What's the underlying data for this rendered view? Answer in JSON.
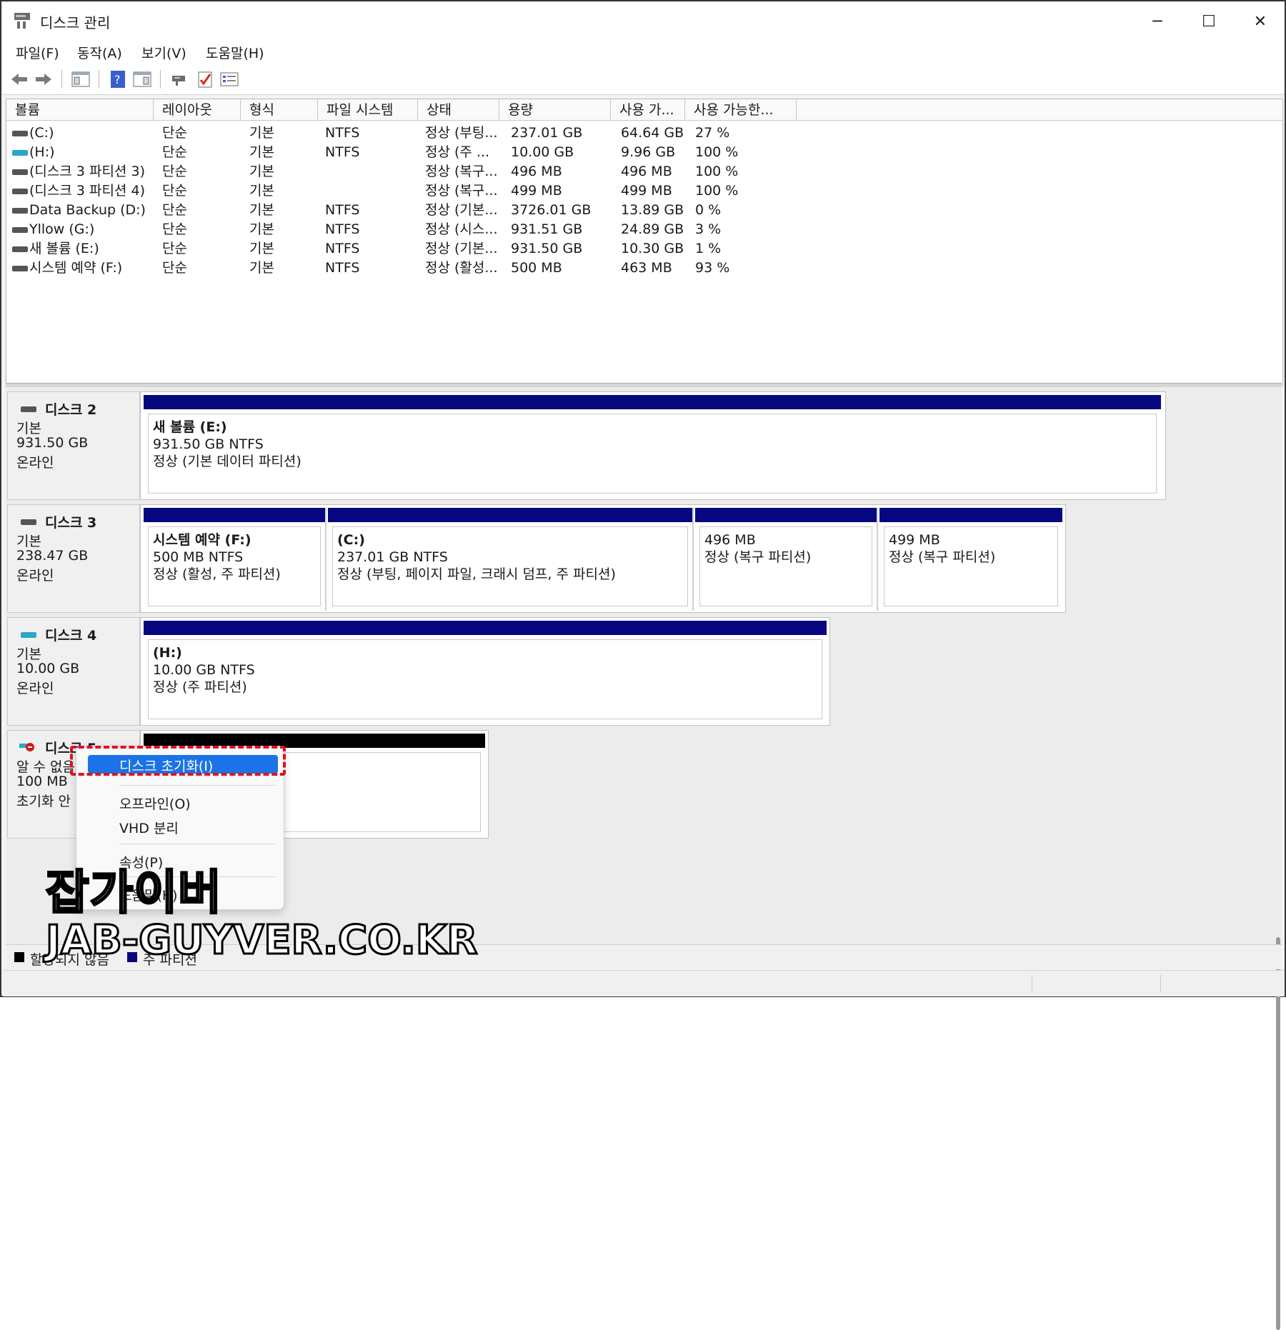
{
  "window": {
    "title": "디스크 관리",
    "minimize": "─",
    "maximize": "☐",
    "close": "✕"
  },
  "menu": [
    "파일(F)",
    "동작(A)",
    "보기(V)",
    "도움말(H)"
  ],
  "toolbar_icons": [
    "back-icon",
    "forward-icon",
    "show-hide-console-icon",
    "help-icon",
    "action-pane-icon",
    "connect-icon",
    "check-icon",
    "properties-icon"
  ],
  "volume_table": {
    "headers": [
      "볼륨",
      "레이아웃",
      "형식",
      "파일 시스템",
      "상태",
      "용량",
      "사용 가...",
      "사용 가능한..."
    ],
    "rows": [
      [
        "(C:)",
        "단순",
        "기본",
        "NTFS",
        "정상 (부팅...",
        "237.01 GB",
        "64.64 GB",
        "27 %"
      ],
      [
        "(H:)",
        "단순",
        "기본",
        "NTFS",
        "정상 (주 ...",
        "10.00 GB",
        "9.96 GB",
        "100 %"
      ],
      [
        "(디스크 3 파티션 3)",
        "단순",
        "기본",
        "",
        "정상 (복구...",
        "496 MB",
        "496 MB",
        "100 %"
      ],
      [
        "(디스크 3 파티션 4)",
        "단순",
        "기본",
        "",
        "정상 (복구...",
        "499 MB",
        "499 MB",
        "100 %"
      ],
      [
        "Data Backup (D:)",
        "단순",
        "기본",
        "NTFS",
        "정상 (기본...",
        "3726.01 GB",
        "13.89 GB",
        "0 %"
      ],
      [
        "Yllow (G:)",
        "단순",
        "기본",
        "NTFS",
        "정상 (시스...",
        "931.51 GB",
        "24.89 GB",
        "3 %"
      ],
      [
        "새 볼륨 (E:)",
        "단순",
        "기본",
        "NTFS",
        "정상 (기본...",
        "931.50 GB",
        "10.30 GB",
        "1 %"
      ],
      [
        "시스템 예약 (F:)",
        "단순",
        "기본",
        "NTFS",
        "정상 (활성...",
        "500 MB",
        "463 MB",
        "93 %"
      ]
    ]
  },
  "disks": [
    {
      "name": "디스크 2",
      "type": "기본",
      "size": "931.50 GB",
      "state": "온라인",
      "partitions": [
        {
          "name": "새 볼륨  (E:)",
          "size": "931.50 GB NTFS",
          "status": "정상 (기본 데이터 파티션)"
        }
      ]
    },
    {
      "name": "디스크 3",
      "type": "기본",
      "size": "238.47 GB",
      "state": "온라인",
      "partitions": [
        {
          "name": "시스템 예약  (F:)",
          "size": "500 MB NTFS",
          "status": "정상 (활성, 주 파티션)"
        },
        {
          "name": "(C:)",
          "size": "237.01 GB NTFS",
          "status": "정상 (부팅, 페이지 파일, 크래시 덤프, 주 파티션)"
        },
        {
          "name": "",
          "size": "496 MB",
          "status": "정상 (복구 파티션)"
        },
        {
          "name": "",
          "size": "499 MB",
          "status": "정상 (복구 파티션)"
        }
      ]
    },
    {
      "name": "디스크 4",
      "type": "기본",
      "size": "10.00 GB",
      "state": "온라인",
      "partitions": [
        {
          "name": "(H:)",
          "size": "10.00 GB NTFS",
          "status": "정상 (주 파티션)"
        }
      ]
    },
    {
      "name": "디스크 5",
      "type": "알 수 없음",
      "size": "100 MB",
      "state": "초기화 안 됨"
    }
  ],
  "context_menu": {
    "items": [
      "디스크 초기화(I)",
      "오프라인(O)",
      "VHD 분리",
      "속성(P)",
      "도움말(H)"
    ]
  },
  "legend": {
    "unallocated": "할당되지 않음",
    "primary": "주 파티션"
  },
  "watermark": {
    "line1": "잡가이버",
    "line2": "JAB-GUYVER.CO.KR"
  },
  "colors": {
    "partition_bar": "#07077f",
    "unallocated_bar": "#000000",
    "highlight": "#1a73e8",
    "callout": "#e01025"
  }
}
